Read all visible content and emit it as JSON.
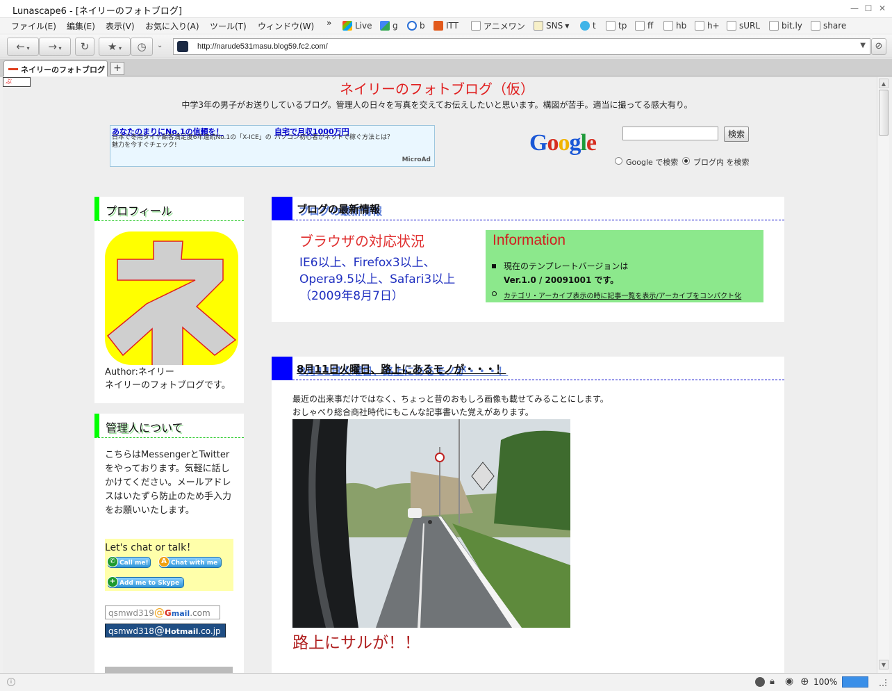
{
  "window": {
    "title": "Lunascape6 - [ネイリーのフォトブログ]"
  },
  "menubar": {
    "items": [
      "ファイル(E)",
      "編集(E)",
      "表示(V)",
      "お気に入り(A)",
      "ツール(T)",
      "ウィンドウ(W)"
    ],
    "overflow": "»",
    "bookmarks": [
      "Live",
      "g",
      "b",
      "ITT",
      "アニメワン",
      "SNS",
      "t",
      "tp",
      "ff",
      "hb",
      "h+",
      "sURL",
      "bit.ly",
      "share"
    ]
  },
  "navbar": {
    "address": "http://narude531masu.blog59.fc2.com/"
  },
  "tabs": {
    "active": "ネイリーのフォトブログ",
    "new_tab": "+"
  },
  "page": {
    "title": "ネイリーのフォトブログ（仮）",
    "description": "中学3年の男子がお送りしているブログ。管理人の日々を写真を交えてお伝えしたいと思います。構図が苦手。適当に撮ってる感大有り。",
    "ad": {
      "link1": "あなたのまりにNo.1の信頼を！",
      "text1": "日本で冬用タイヤ顧客満足度6年連続No.1の「X-ICE」の魅力を今すぐチェック!",
      "link2": "自宅で月収1000万円",
      "text2": "パソコン初心者がネットで稼ぐ方法とは？",
      "provider": "MicroAd"
    },
    "search": {
      "logo": "Google",
      "button": "検索",
      "option_google": "Google で検索",
      "option_blog": "ブログ内 を検索"
    }
  },
  "sidebar": {
    "profile": {
      "heading": "プロフィール",
      "avatar_char": "ネ",
      "author": "Author:ネイリー",
      "bio": "ネイリーのフォトブログです。"
    },
    "admin": {
      "heading": "管理人について",
      "lines": [
        "こちらはMessengerとTwitter",
        "をやっております。気軽に話し",
        "かけてください。メールアドレ",
        "スはいたずら防止のため手入力",
        "をお願いいたします。"
      ],
      "chat_title": "Let's chat or talk！",
      "call_btn": "Call me!",
      "chat_btn": "Chat with me",
      "skype_btn": "Add me to Skype",
      "gmail_user": "qsmwd319",
      "gmail_at": "@",
      "gmail_domain_g": "G",
      "gmail_domain": "mail",
      "gmail_tld": ".com",
      "hotmail_user": "qsmwd318",
      "hotmail_at": "@",
      "hotmail_domain": "Hotmail",
      "hotmail_tld": ".co.jp"
    }
  },
  "main": {
    "latest": {
      "heading": "ブログの最新情報",
      "browser_title": "ブラウザの対応状況",
      "browser_lines": [
        "IE6以上、Firefox3以上、",
        "Opera9.5以上、Safari3以上",
        "（2009年8月7日）"
      ],
      "info_title": "Information",
      "info_line1": "現在のテンプレートバージョンは",
      "info_line2": "Ver.1.0 / 20091001 です。",
      "info_link1": "カテゴリ・アーカイブ表示の時に記事一覧を表示",
      "info_sep": "/",
      "info_link2": "アーカイブをコンパクト化"
    },
    "article": {
      "heading": "8月11日火曜日、路上にあるモノが・・・！",
      "line1": "最近の出来事だけではなく、ちょっと昔のおもしろ画像も載せてみることにします。",
      "line2": "おしゃべり総合商社時代にもこんな記事書いた覚えがあります。",
      "caption": "路上にサルが！！"
    }
  },
  "status": {
    "zoom": "100%"
  },
  "colors": {
    "title_red": "#e02020",
    "sidebar_accent": "#00ff00",
    "main_accent": "#0000ff",
    "info_bg": "#8ce88c",
    "avatar_bg": "#ffff00"
  }
}
